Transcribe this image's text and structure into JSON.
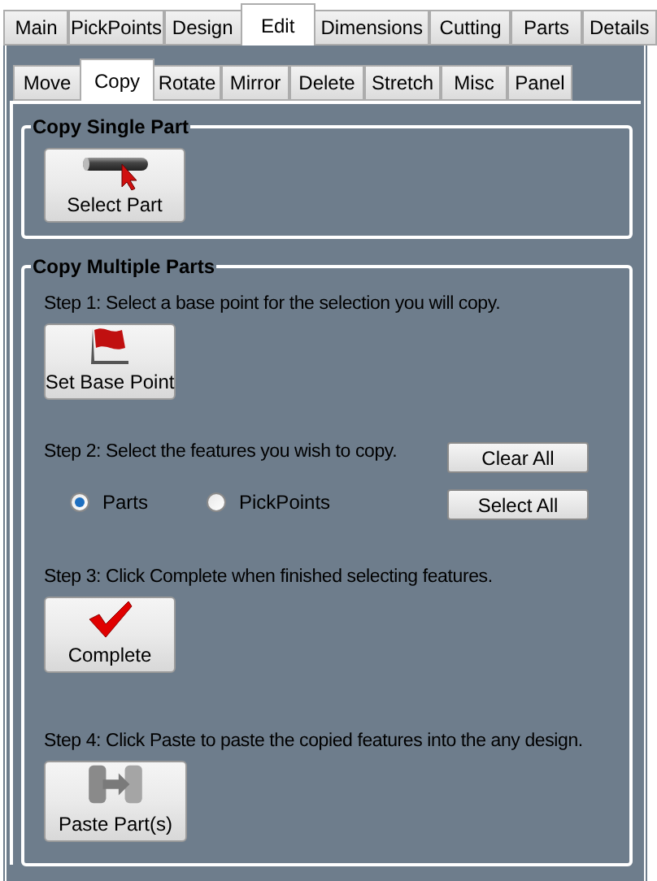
{
  "outer_tabs": [
    {
      "label": "Main",
      "selected": false
    },
    {
      "label": "PickPoints",
      "selected": false
    },
    {
      "label": "Design",
      "selected": false
    },
    {
      "label": "Edit",
      "selected": true
    },
    {
      "label": "Dimensions",
      "selected": false
    },
    {
      "label": "Cutting",
      "selected": false
    },
    {
      "label": "Parts",
      "selected": false
    },
    {
      "label": "Details",
      "selected": false
    }
  ],
  "inner_tabs": [
    {
      "label": "Move",
      "selected": false
    },
    {
      "label": "Copy",
      "selected": true
    },
    {
      "label": "Rotate",
      "selected": false
    },
    {
      "label": "Mirror",
      "selected": false
    },
    {
      "label": "Delete",
      "selected": false
    },
    {
      "label": "Stretch",
      "selected": false
    },
    {
      "label": "Misc",
      "selected": false
    },
    {
      "label": "Panel",
      "selected": false
    }
  ],
  "copy_single_part": {
    "title": "Copy Single Part",
    "button": "Select Part"
  },
  "copy_multiple_parts": {
    "title": "Copy Multiple Parts",
    "step1": {
      "text": "Step 1: Select a base point for the selection you will copy.",
      "button": "Set Base Point"
    },
    "step2": {
      "text": "Step 2: Select the features you wish to copy.",
      "options": [
        {
          "label": "Parts",
          "selected": true
        },
        {
          "label": "PickPoints",
          "selected": false
        }
      ],
      "buttons": [
        "Clear All",
        "Select All"
      ]
    },
    "step3": {
      "text": "Step 3: Click Complete when finished selecting features.",
      "button": "Complete"
    },
    "step4": {
      "text": "Step 4: Click Paste to paste the copied features into the any design.",
      "button": "Paste Part(s)"
    }
  }
}
